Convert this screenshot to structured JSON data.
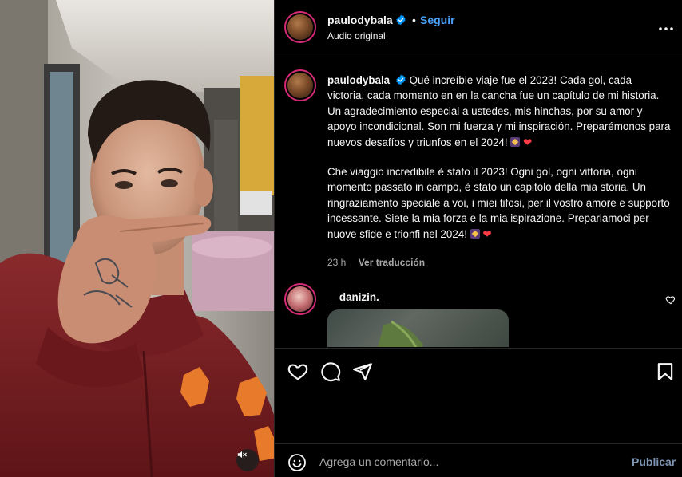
{
  "header": {
    "username": "paulodybala",
    "follow_label": "Seguir",
    "separator": "•",
    "audio": "Audio original",
    "verified_icon": "verified-badge-icon",
    "more_icon": "more-options-icon"
  },
  "caption": {
    "username": "paulodybala",
    "text_es": "Qué increíble viaje fue el 2023! Cada gol, cada victoria, cada momento en en la cancha fue un capítulo de mi historia. Un agradecimiento especial a ustedes, mis hinchas, por su amor y apoyo incondicional. Son mi fuerza y mi inspiración. Preparémonos para nuevos desafíos y triunfos en el 2024!",
    "text_it": "Che viaggio incredibile è stato il 2023! Ogni gol, ogni vittoria, ogni momento passato in campo, è stato un capitolo della mia storia. Un ringraziamento speciale a voi, i miei tifosi, per il vostro amore e supporto incessante. Siete la mia forza e la mia ispirazione. Prepariamoci per nuove sfide e trionfi nel 2024!",
    "heart_emoji": "❤",
    "time": "23 h",
    "translate_label": "Ver traducción"
  },
  "comment": {
    "username": "__danizin._"
  },
  "actions": {
    "like_icon": "heart-icon",
    "comment_icon": "comment-icon",
    "share_icon": "send-icon",
    "save_icon": "bookmark-icon"
  },
  "add_comment": {
    "placeholder": "Agrega un comentario...",
    "publish_label": "Publicar",
    "emoji_icon": "emoji-icon"
  },
  "media": {
    "mute_icon": "muted-speaker-icon"
  },
  "colors": {
    "accent": "#4aa2f8",
    "background": "#000000",
    "jersey": "#7b1f24",
    "logo": "#e87a2c"
  }
}
